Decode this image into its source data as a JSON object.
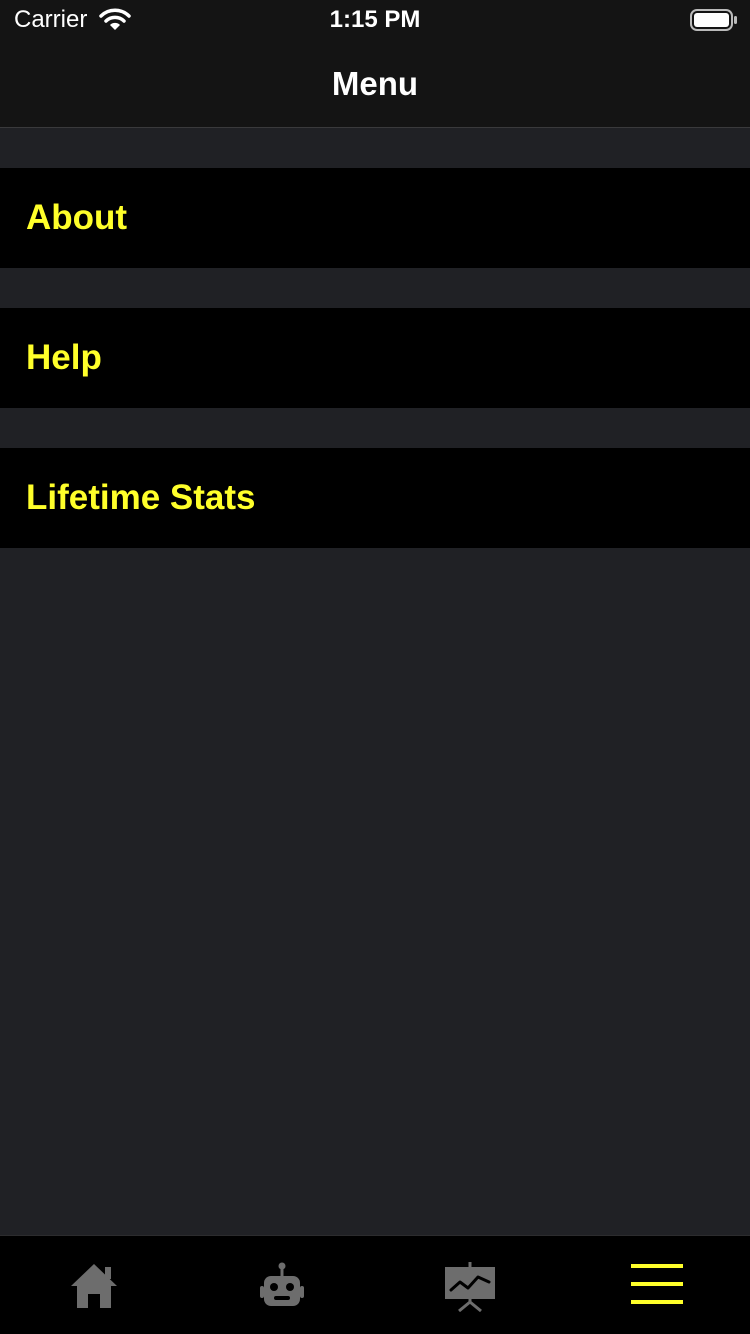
{
  "status_bar": {
    "carrier": "Carrier",
    "time": "1:15 PM"
  },
  "nav": {
    "title": "Menu"
  },
  "menu": {
    "items": [
      {
        "label": "About"
      },
      {
        "label": "Help"
      },
      {
        "label": "Lifetime Stats"
      }
    ]
  },
  "tab_bar": {
    "tabs": [
      {
        "icon": "home-icon",
        "selected": false
      },
      {
        "icon": "robot-icon",
        "selected": false
      },
      {
        "icon": "stats-chart-icon",
        "selected": false
      },
      {
        "icon": "menu-icon",
        "selected": true
      }
    ]
  },
  "colors": {
    "accent": "#ffff2a",
    "background": "#202125",
    "bar": "#141414",
    "cell": "#000000",
    "inactive_icon": "#6d6d6d"
  }
}
